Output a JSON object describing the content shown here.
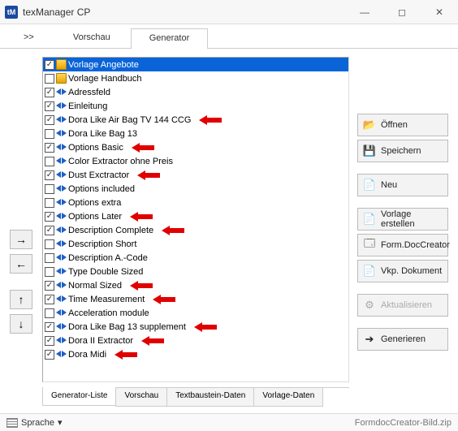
{
  "window": {
    "app_icon_text": "tM",
    "title": "texManager CP"
  },
  "top_tabs": [
    {
      "label": ">>",
      "active": false
    },
    {
      "label": "Vorschau",
      "active": false
    },
    {
      "label": "Generator",
      "active": true
    }
  ],
  "list": {
    "items": [
      {
        "checked": true,
        "icon": "tpl",
        "label": "Vorlage Angebote",
        "arrow": false,
        "selected": true
      },
      {
        "checked": false,
        "icon": "tpl",
        "label": "Vorlage Handbuch",
        "arrow": false
      },
      {
        "checked": true,
        "icon": "blue",
        "label": "Adressfeld",
        "arrow": false
      },
      {
        "checked": true,
        "icon": "blue",
        "label": "Einleitung",
        "arrow": false
      },
      {
        "checked": true,
        "icon": "blue",
        "label": "Dora Like Air Bag TV 144 CCG",
        "arrow": true
      },
      {
        "checked": false,
        "icon": "blue",
        "label": "Dora Like Bag 13",
        "arrow": false
      },
      {
        "checked": true,
        "icon": "blue",
        "label": "Options Basic",
        "arrow": true
      },
      {
        "checked": false,
        "icon": "blue",
        "label": "Color Extractor ohne Preis",
        "arrow": false
      },
      {
        "checked": true,
        "icon": "blue",
        "label": "Dust Exctractor",
        "arrow": true
      },
      {
        "checked": false,
        "icon": "blue",
        "label": "Options included",
        "arrow": false
      },
      {
        "checked": false,
        "icon": "blue",
        "label": "Options extra",
        "arrow": false
      },
      {
        "checked": true,
        "icon": "blue",
        "label": "Options Later",
        "arrow": true
      },
      {
        "checked": true,
        "icon": "blue",
        "label": "Description Complete",
        "arrow": true
      },
      {
        "checked": false,
        "icon": "blue",
        "label": "Description Short",
        "arrow": false
      },
      {
        "checked": false,
        "icon": "blue",
        "label": "Description A.-Code",
        "arrow": false
      },
      {
        "checked": false,
        "icon": "blue",
        "label": "Type Double Sized",
        "arrow": false
      },
      {
        "checked": true,
        "icon": "blue",
        "label": "Normal Sized",
        "arrow": true
      },
      {
        "checked": true,
        "icon": "blue",
        "label": "Time Measurement",
        "arrow": true
      },
      {
        "checked": false,
        "icon": "blue",
        "label": "Acceleration module",
        "arrow": false
      },
      {
        "checked": true,
        "icon": "blue",
        "label": "Dora Like Bag 13 supplement",
        "arrow": true
      },
      {
        "checked": true,
        "icon": "blue",
        "label": "Dora II Extractor",
        "arrow": true
      },
      {
        "checked": true,
        "icon": "blue",
        "label": "Dora Midi",
        "arrow": true
      }
    ]
  },
  "nav_arrows": {
    "right": "→",
    "left": "←",
    "up": "↑",
    "down": "↓"
  },
  "side_buttons": [
    {
      "id": "open",
      "label": "Öffnen",
      "icon": "📂",
      "disabled": false
    },
    {
      "id": "save",
      "label": "Speichern",
      "icon": "💾",
      "disabled": false
    },
    {
      "id": "new",
      "label": "Neu",
      "icon": "📄",
      "disabled": false
    },
    {
      "id": "create-tpl",
      "label": "Vorlage erstellen",
      "icon": "📄",
      "disabled": false
    },
    {
      "id": "form-doc",
      "label": "Form.DocCreator",
      "icon": "🗔",
      "disabled": false
    },
    {
      "id": "vkp-doc",
      "label": "Vkp. Dokument",
      "icon": "📄",
      "disabled": false
    },
    {
      "id": "refresh",
      "label": "Aktualisieren",
      "icon": "⚙",
      "disabled": true
    },
    {
      "id": "generate",
      "label": "Generieren",
      "icon": "➔",
      "disabled": false
    }
  ],
  "bottom_tabs": [
    {
      "label": "Generator-Liste",
      "active": true
    },
    {
      "label": "Vorschau",
      "active": false
    },
    {
      "label": "Textbaustein-Daten",
      "active": false
    },
    {
      "label": "Vorlage-Daten",
      "active": false
    }
  ],
  "statusbar": {
    "language_label": "Sprache",
    "right_text": "FormdocCreator-Bild.zip"
  }
}
